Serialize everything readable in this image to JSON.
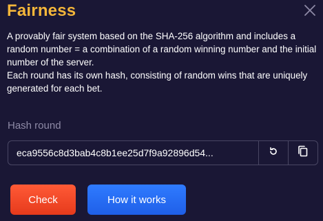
{
  "modal": {
    "title": "Fairness",
    "description": [
      "A provably fair system based on the SHA-256 algorithm and includes a random number = a combination of a random winning number and the initial number of the server.",
      "Each round has its own hash, consisting of random wins that are uniquely generated for each bet."
    ],
    "hash_label": "Hash round",
    "hash_value": "eca9556c8d3bab4c8b1ee25d7f9a92896d54...",
    "buttons": {
      "check": "Check",
      "how_it_works": "How it works"
    },
    "icons": {
      "close": "close-icon",
      "refresh": "refresh-icon",
      "copy": "copy-icon"
    }
  },
  "colors": {
    "background": "#1a1735",
    "title": "#f4b63a",
    "check_button": "#f2482a",
    "how_button": "#2a6ff5",
    "label": "#8e8aa6",
    "border": "#4a4764"
  }
}
